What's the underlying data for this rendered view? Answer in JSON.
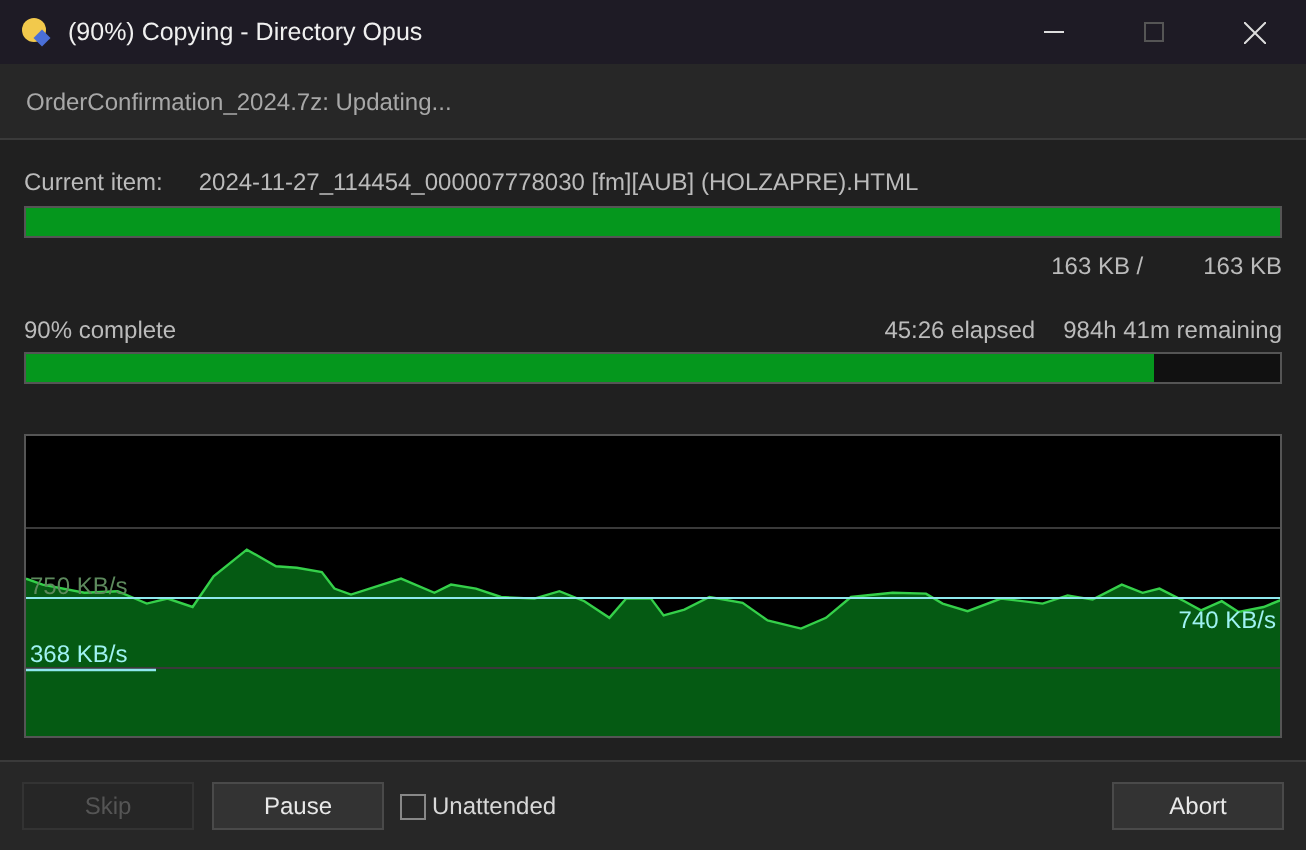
{
  "window": {
    "title": "(90%) Copying - Directory Opus"
  },
  "status": "OrderConfirmation_2024.7z: Updating...",
  "current_item": {
    "label": "Current item:",
    "name": "2024-11-27_114454_000007778030 [fm][AUB] (HOLZAPRE).HTML",
    "level": 1,
    "done": "163 KB /",
    "total": "163 KB"
  },
  "overall": {
    "label": "90% complete",
    "elapsed": "45:26 elapsed",
    "remaining": "984h 41m remaining",
    "level": 0.9
  },
  "graph": {
    "average_label": "750 KB/s",
    "current_label": "740 KB/s",
    "low_label": "368 KB/s"
  },
  "buttons": [
    {
      "label": "Skip",
      "disabled": true
    },
    {
      "label": "Pause",
      "disabled": false
    }
  ],
  "unattended": {
    "label": "Unattended",
    "checked": false
  },
  "abort": {
    "label": "Abort",
    "disabled": false
  }
}
